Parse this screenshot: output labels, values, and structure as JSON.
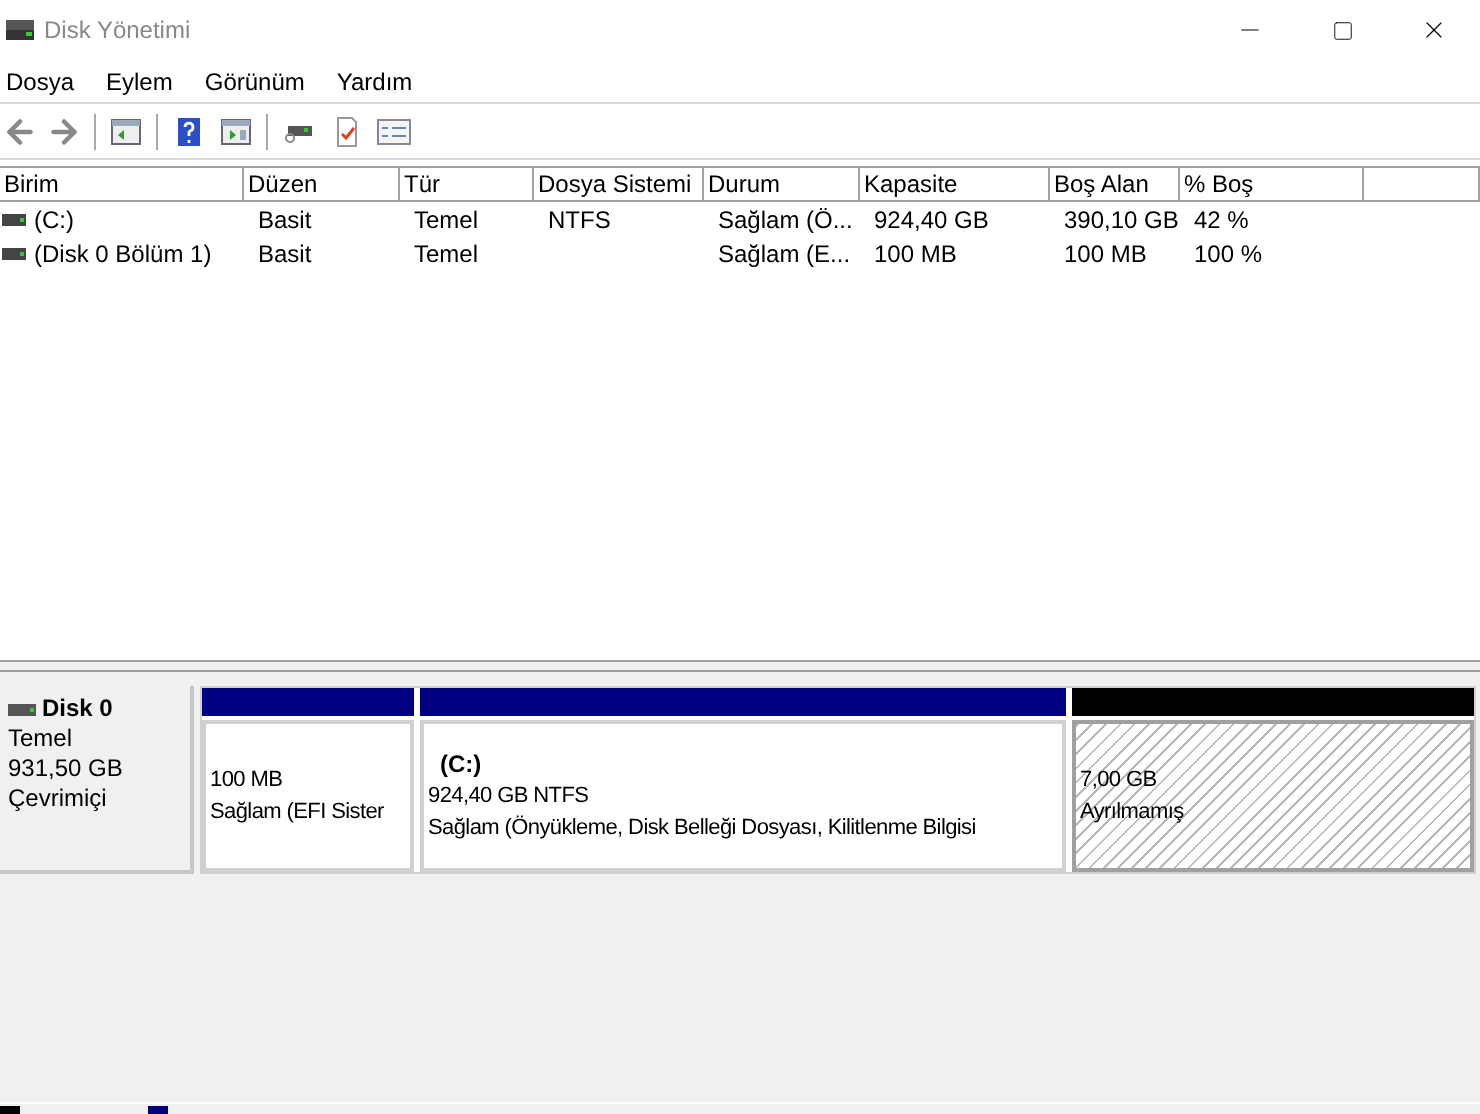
{
  "window": {
    "title": "Disk Yönetimi"
  },
  "menu": [
    "Dosya",
    "Eylem",
    "Görünüm",
    "Yardım"
  ],
  "table": {
    "columns": [
      "Birim",
      "Düzen",
      "Tür",
      "Dosya Sistemi",
      "Durum",
      "Kapasite",
      "Boş Alan",
      "% Boş"
    ],
    "rows": [
      {
        "cells": [
          "(C:)",
          "Basit",
          "Temel",
          "NTFS",
          "Sağlam (Ö...",
          "924,40 GB",
          "390,10 GB",
          "42 %"
        ]
      },
      {
        "cells": [
          "(Disk 0 Bölüm 1)",
          "Basit",
          "Temel",
          "",
          "Sağlam (E...",
          "100 MB",
          "100 MB",
          "100 %"
        ]
      }
    ]
  },
  "disks": [
    {
      "name": "Disk 0",
      "type": "Temel",
      "size": "931,50 GB",
      "status": "Çevrimiçi",
      "partitions": [
        {
          "kind": "primary",
          "lines": [
            "100 MB",
            "Sağlam (EFI Sister"
          ]
        },
        {
          "kind": "primary",
          "label": "(C:)",
          "lines": [
            "924,40 GB NTFS",
            "Sağlam (Önyükleme, Disk Belleği Dosyası, Kilitlenme Bilgisi"
          ]
        },
        {
          "kind": "unallocated",
          "lines": [
            "7,00 GB",
            "Ayrılmamış"
          ]
        }
      ]
    }
  ],
  "legend": [
    {
      "color": "#000000"
    },
    {
      "color": "#000080"
    }
  ]
}
